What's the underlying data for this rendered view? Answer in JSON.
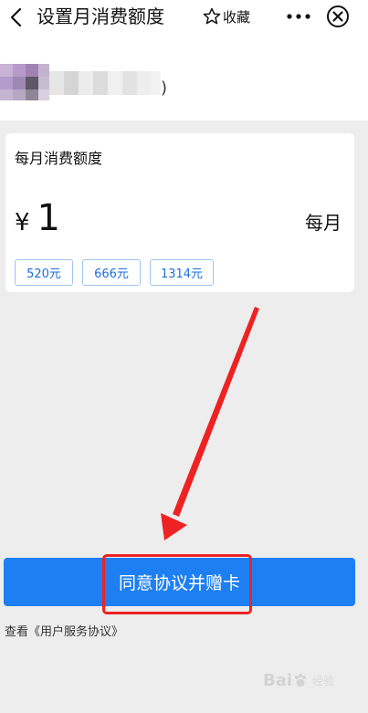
{
  "header": {
    "title": "设置月消费额度",
    "favorite_label": "收藏",
    "icons": [
      "back-chevron-icon",
      "star-icon",
      "more-dots-icon",
      "close-circle-icon"
    ]
  },
  "user": {
    "name_tail": ")"
  },
  "card": {
    "title": "每月消费额度",
    "currency": "¥",
    "amount": "1",
    "period": "每月",
    "quick_amounts": [
      "520元",
      "666元",
      "1314元"
    ]
  },
  "action": {
    "agree_button": "同意协议并赠卡",
    "agreement_prefix": "查看",
    "agreement_link": "《用户服务协议》"
  },
  "watermark": {
    "text": "Bai",
    "sub": "经验"
  },
  "colors": {
    "accent": "#1e7ff3",
    "chip_text": "#1a6fd8",
    "annotation": "#ee2222",
    "background": "#ededed"
  }
}
